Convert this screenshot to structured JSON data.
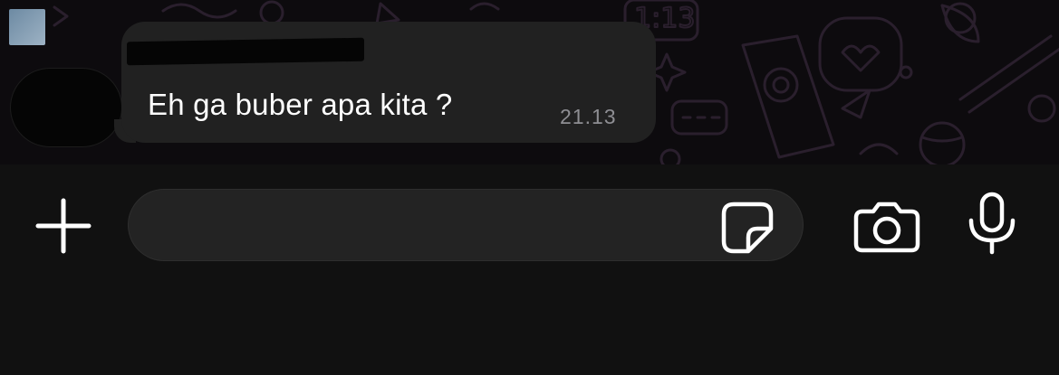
{
  "colors": {
    "background": "#111111",
    "chat_wallpaper": "#0d0b0e",
    "doodle_stroke": "#2a1f2d",
    "bubble": "#212121",
    "message_text": "#ffffff",
    "timestamp_text": "#8e8e93",
    "input_background": "#232323",
    "icon": "#ffffff"
  },
  "chat": {
    "group_avatar_icon": "group-avatar-icon",
    "sender_avatar_icon": "avatar-icon",
    "message": {
      "sender": "",
      "text": "Eh ga buber apa kita ?",
      "time": "21.13"
    }
  },
  "composer": {
    "attach_icon": "plus-icon",
    "input_value": "",
    "input_placeholder": "",
    "sticker_icon": "sticker-icon",
    "camera_icon": "camera-icon",
    "mic_icon": "microphone-icon"
  }
}
